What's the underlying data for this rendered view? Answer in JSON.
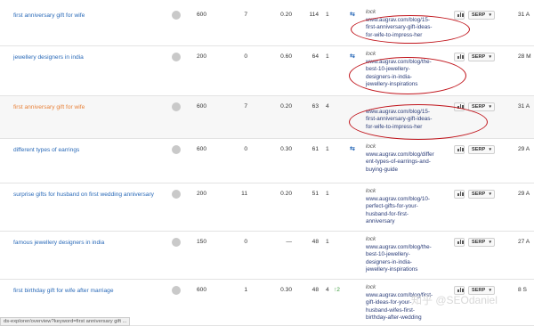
{
  "rows": [
    {
      "keyword": "first anniversary gift for wife",
      "keyword_color": "blue",
      "kd": "",
      "volume": "600",
      "clicks": "7",
      "cpc": "0.20",
      "traffic": "114",
      "position": "1",
      "position_change": "",
      "has_arrows": true,
      "url_lines": [
        "www.augrav.com/blog/15-",
        "first-anniversary-gift-ideas-",
        "for-wife-to-impress-her"
      ],
      "url_caret": "▾",
      "lock": "lock",
      "serp": "SERP",
      "date": "31 A"
    },
    {
      "keyword": "jewellery designers in india",
      "keyword_color": "blue",
      "kd": "",
      "volume": "200",
      "clicks": "0",
      "cpc": "0.60",
      "traffic": "64",
      "position": "1",
      "position_change": "",
      "has_arrows": true,
      "url_lines": [
        "www.augrav.com/blog/the-",
        "best-10-jewellery-",
        "designers-in-india-",
        "jewellery-inspirations"
      ],
      "url_caret": "▾",
      "lock": "lock",
      "serp": "SERP",
      "date": "28 M"
    },
    {
      "keyword": "first anniversary gift for wife",
      "keyword_color": "orange",
      "kd": "",
      "volume": "600",
      "clicks": "7",
      "cpc": "0.20",
      "traffic": "63",
      "position": "4",
      "position_change": "",
      "has_arrows": false,
      "url_lines": [
        "www.augrav.com/blog/15-",
        "first-anniversary-gift-ideas-",
        "for-wife-to-impress-her"
      ],
      "url_caret": "▾",
      "lock": "",
      "serp": "SERP",
      "date": "31 A"
    },
    {
      "keyword": "different types of earrings",
      "keyword_color": "blue",
      "kd": "",
      "volume": "600",
      "clicks": "0",
      "cpc": "0.30",
      "traffic": "61",
      "position": "1",
      "position_change": "",
      "has_arrows": true,
      "url_lines": [
        "www.augrav.com/blog/differ",
        "ent-types-of-earrings-and-",
        "buying-guide"
      ],
      "url_caret": "▾",
      "lock": "lock",
      "serp": "SERP",
      "date": "29 A"
    },
    {
      "keyword": "surprise gifts for husband on first wedding anniversary",
      "keyword_color": "blue",
      "kd": "",
      "volume": "200",
      "clicks": "11",
      "cpc": "0.20",
      "traffic": "51",
      "position": "1",
      "position_change": "",
      "has_arrows": false,
      "url_lines": [
        "www.augrav.com/blog/10-",
        "perfect-gifts-for-your-",
        "husband-for-first-",
        "anniversary"
      ],
      "url_caret": "▾",
      "lock": "lock",
      "serp": "SERP",
      "date": "29 A"
    },
    {
      "keyword": "famous jewellery designers in india",
      "keyword_color": "blue",
      "kd": "",
      "volume": "150",
      "clicks": "0",
      "cpc": "—",
      "traffic": "48",
      "position": "1",
      "position_change": "",
      "has_arrows": false,
      "url_lines": [
        "www.augrav.com/blog/the-",
        "best-10-jewellery-",
        "designers-in-india-",
        "jewellery-inspirations"
      ],
      "url_caret": "▾",
      "lock": "lock",
      "serp": "SERP",
      "date": "27 A"
    },
    {
      "keyword": "first birthday gift for wife after marriage",
      "keyword_color": "blue",
      "kd": "",
      "volume": "600",
      "clicks": "1",
      "cpc": "0.30",
      "traffic": "48",
      "position": "4",
      "position_change": "↑2",
      "has_arrows": false,
      "url_lines": [
        "www.augrav.com/blog/first-",
        "gift-ideas-for-your-",
        "husband-wifes-first-",
        "birthday-after-wedding"
      ],
      "url_caret": "▾",
      "lock": "lock",
      "serp": "SERP",
      "date": "8 S"
    }
  ],
  "status_bar": "ds-explorer/overview?keyword=first anniversary gift ...",
  "watermark": "知乎 @SEOdaniel",
  "colors": {
    "link": "#2a6ab8",
    "highlight_keyword": "#e8823a",
    "annotation": "#c0141b",
    "up": "#3a9a3a"
  }
}
